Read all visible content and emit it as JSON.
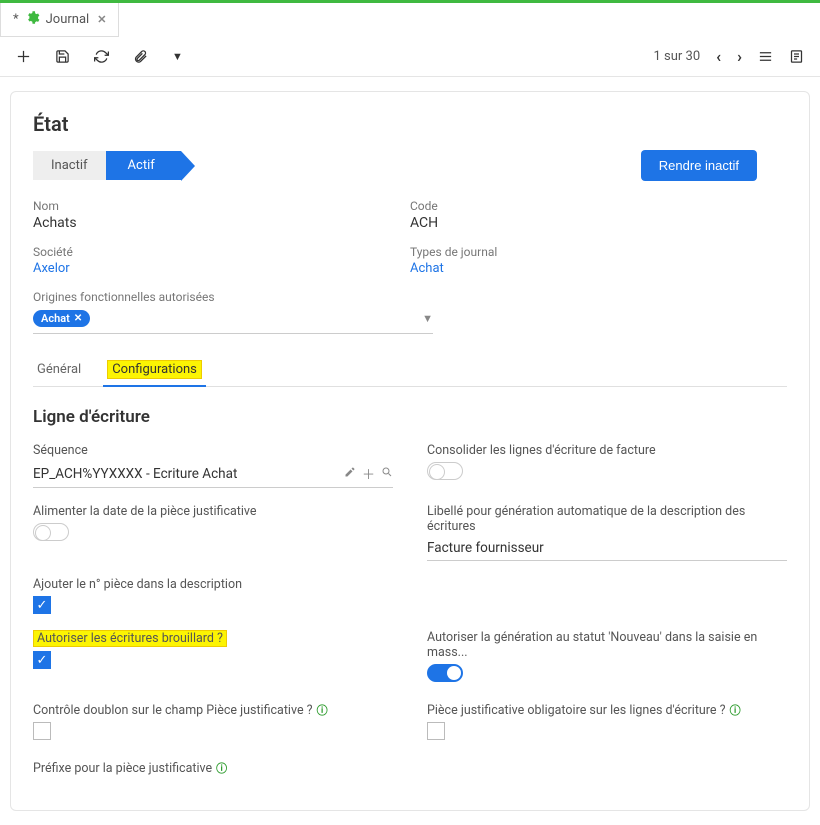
{
  "tab": {
    "prefix": "*",
    "title": "Journal"
  },
  "toolbar": {
    "pager": "1 sur 30"
  },
  "header": {
    "title": "État",
    "status_inactive": "Inactif",
    "status_active": "Actif",
    "btn_inactive": "Rendre inactif"
  },
  "fields": {
    "name_label": "Nom",
    "name_value": "Achats",
    "code_label": "Code",
    "code_value": "ACH",
    "company_label": "Société",
    "company_value": "Axelor",
    "journal_type_label": "Types de journal",
    "journal_type_value": "Achat",
    "origins_label": "Origines fonctionnelles autorisées",
    "origins_tag": "Achat"
  },
  "tabs": {
    "general": "Général",
    "config": "Configurations"
  },
  "section": {
    "title": "Ligne d'écriture"
  },
  "form": {
    "sequence_label": "Séquence",
    "sequence_value": "EP_ACH%YYXXXX - Ecriture Achat",
    "consolidate_label": "Consolider les lignes d'écriture de facture",
    "feed_date_label": "Alimenter la date de la pièce justificative",
    "desc_gen_label": "Libellé pour génération automatique de la description des écritures",
    "desc_gen_value": "Facture fournisseur",
    "add_piece_label": "Ajouter le n° pièce dans la description",
    "allow_draft_label": "Autoriser les écritures brouillard ?",
    "allow_gen_new_label": "Autoriser la génération au statut 'Nouveau' dans la saisie en mass...",
    "dup_check_label": "Contrôle doublon sur le champ Pièce justificative ?",
    "justif_required_label": "Pièce justificative obligatoire sur les lignes d'écriture ?",
    "prefix_label": "Préfixe pour la pièce justificative"
  }
}
